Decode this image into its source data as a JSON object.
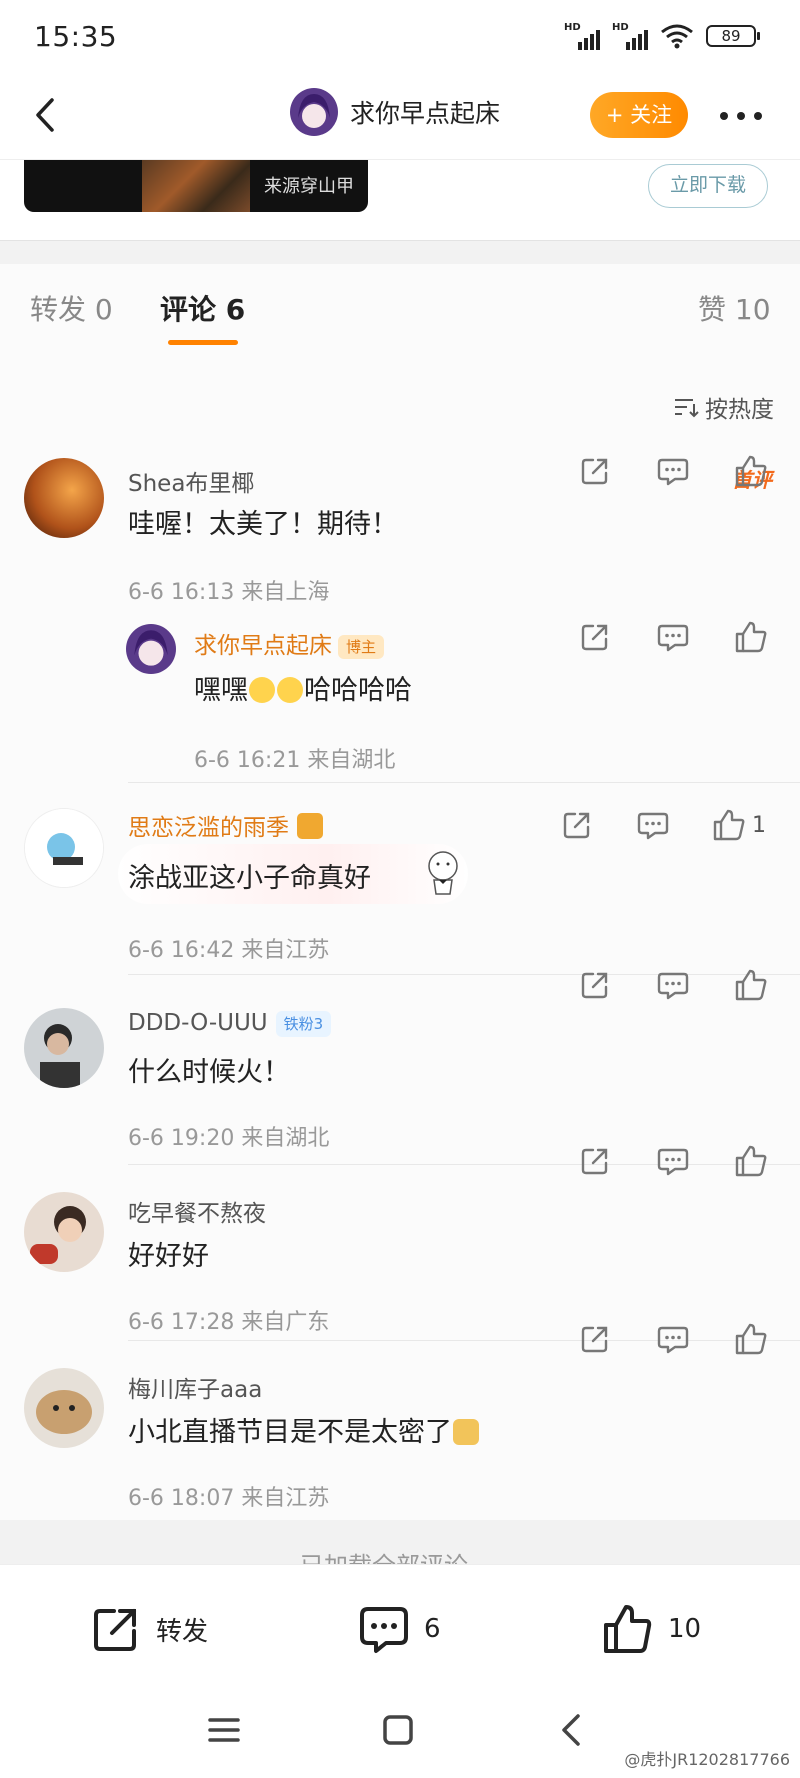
{
  "status_bar": {
    "time": "15:35",
    "signal_1": "HD",
    "signal_2": "HD",
    "battery": "89"
  },
  "nav": {
    "back_icon": "chevron-left-icon",
    "user_name": "求你早点起床",
    "follow_label": "+ 关注",
    "more_icon": "more-horizontal-icon"
  },
  "card": {
    "source": "来源穿山甲",
    "download_label": "立即下载"
  },
  "tabs": [
    {
      "label": "转发",
      "count": "0"
    },
    {
      "label": "评论",
      "count": "6"
    },
    {
      "label": "赞",
      "count": "10"
    }
  ],
  "sort_label": "按热度",
  "comments": [
    {
      "name": "Shea布里椰",
      "text": "哇喔！太美了！期待！",
      "time": "6-6 16:13",
      "location": "来自上海",
      "badge": "首评",
      "likes": ""
    },
    {
      "name": "求你早点起床",
      "tag": "博主",
      "text_pre": "嘿嘿",
      "text_post": "哈哈哈哈",
      "time": "6-6 16:21",
      "location": "来自湖北",
      "likes": ""
    },
    {
      "name": "思恋泛滥的雨季",
      "text": "涂战亚这小子命真好",
      "time": "6-6 16:42",
      "location": "来自江苏",
      "likes": "1"
    },
    {
      "name": "DDD-O-UUU",
      "tag": "铁粉3",
      "text": "什么时候火！",
      "time": "6-6 19:20",
      "location": "来自湖北",
      "likes": ""
    },
    {
      "name": "吃早餐不熬夜",
      "text": "好好好",
      "time": "6-6 17:28",
      "location": "来自广东",
      "likes": ""
    },
    {
      "name": "梅川库子aaa",
      "text": "小北直播节目是不是太密了",
      "time": "6-6 18:07",
      "location": "来自江苏",
      "likes": ""
    }
  ],
  "load_all": "已加载全部评论",
  "bottom_bar": {
    "repost_label": "转发",
    "comment_count": "6",
    "like_count": "10"
  },
  "watermark": "@虎扑JR1202817766",
  "colors": {
    "accent": "#ff8200",
    "follow_bg": "#ffa826",
    "name_orange": "#e07b16",
    "text": "#222222",
    "meta": "#999999",
    "blue_tag": "#4a90e2"
  }
}
